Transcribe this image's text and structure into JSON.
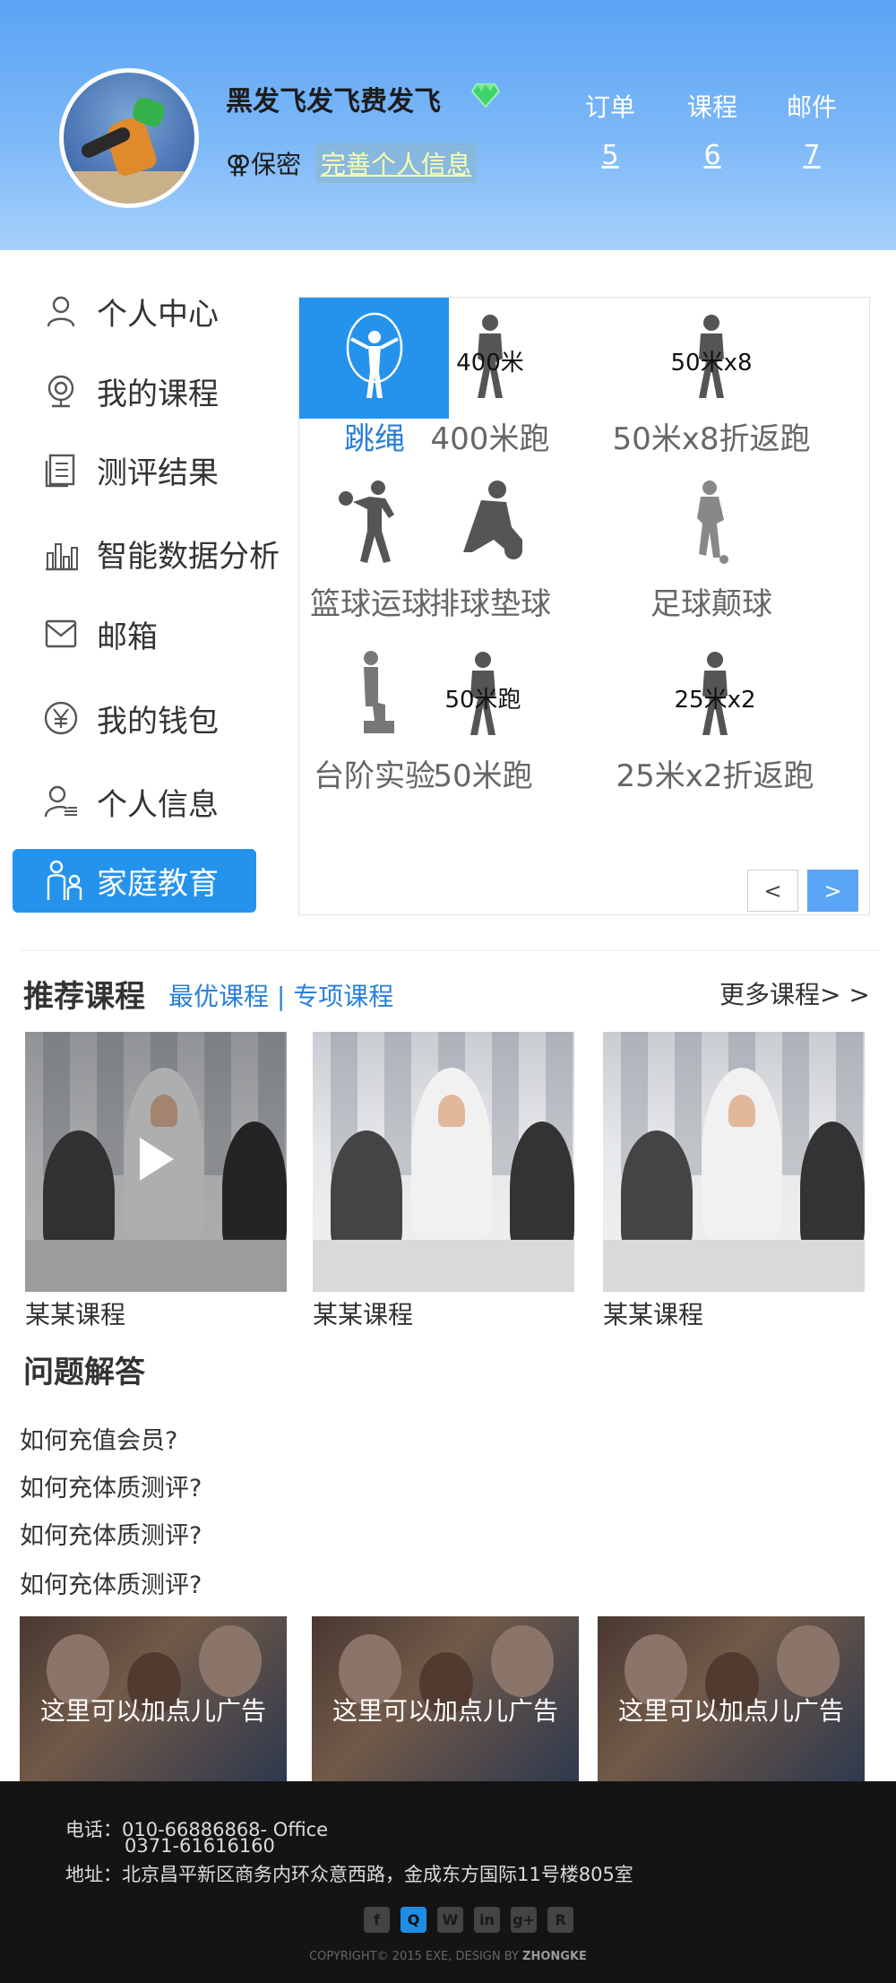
{
  "header": {
    "username": "黑发飞发飞费发飞",
    "gender_text": "保密",
    "complete_link": "完善个人信息",
    "stats": [
      {
        "label": "订单",
        "count": "5"
      },
      {
        "label": "课程",
        "count": "6"
      },
      {
        "label": "邮件",
        "count": "7"
      }
    ]
  },
  "sidebar": {
    "items": [
      {
        "label": "个人中心",
        "icon": "user-icon"
      },
      {
        "label": "我的课程",
        "icon": "webcam-icon"
      },
      {
        "label": "测评结果",
        "icon": "document-icon"
      },
      {
        "label": "智能数据分析",
        "icon": "bar-chart-icon"
      },
      {
        "label": "邮箱",
        "icon": "mail-icon"
      },
      {
        "label": "我的钱包",
        "icon": "yen-icon"
      },
      {
        "label": "个人信息",
        "icon": "profile-icon"
      },
      {
        "label": "家庭教育",
        "icon": "family-icon",
        "active": true
      }
    ]
  },
  "tests": {
    "tiles": [
      {
        "name": "跳绳",
        "overlay": "",
        "icon": "jump-rope-icon",
        "active": true
      },
      {
        "name": "400米跑",
        "overlay": "400米",
        "icon": "runner-icon"
      },
      {
        "name": "50米x8折返跑",
        "overlay": "50米x8",
        "icon": "runner-icon"
      },
      {
        "name": "篮球运球",
        "overlay": "",
        "icon": "basketball-icon"
      },
      {
        "name": "排球垫球",
        "overlay": "",
        "icon": "volleyball-icon"
      },
      {
        "name": "足球颠球",
        "overlay": "",
        "icon": "football-icon"
      },
      {
        "name": "台阶实验",
        "overlay": "",
        "icon": "step-test-icon"
      },
      {
        "name": "50米跑",
        "overlay": "50米跑",
        "icon": "runner-icon"
      },
      {
        "name": "25米x2折返跑",
        "overlay": "25米x2",
        "icon": "runner-icon"
      }
    ],
    "prev_label": "<",
    "next_label": ">"
  },
  "recommend": {
    "title": "推荐课程",
    "link1": "最优课程",
    "divider": "|",
    "link2": "专项课程",
    "more": "更多课程> >",
    "courses": [
      {
        "name": "某某课程"
      },
      {
        "name": "某某课程"
      },
      {
        "name": "某某课程"
      }
    ]
  },
  "qa": {
    "title": "问题解答",
    "items": [
      "如何充值会员?",
      "如何充体质测评?",
      "如何充体质测评?",
      "如何充体质测评?"
    ]
  },
  "ads": [
    "这里可以加点儿广告",
    "这里可以加点儿广告",
    "这里可以加点儿广告"
  ],
  "footer": {
    "phone_line1": "电话：010-66886868- Office",
    "phone_line2": "0371-61616160",
    "address": "地址：北京昌平新区商务内环众意西路，金成东方国际11号楼805室",
    "social": [
      {
        "icon": "facebook-icon",
        "glyph": "f"
      },
      {
        "icon": "qq-icon",
        "glyph": "Q"
      },
      {
        "icon": "wechat-icon",
        "glyph": "W"
      },
      {
        "icon": "linkedin-icon",
        "glyph": "in"
      },
      {
        "icon": "google-plus-icon",
        "glyph": "g+"
      },
      {
        "icon": "rss-icon",
        "glyph": "R"
      }
    ],
    "copyright_prefix": "COPYRIGHT© 2015 EXE, DESIGN BY ",
    "copyright_brand": "ZHONGKE"
  },
  "colors": {
    "accent": "#2593ec",
    "header_top": "#5aa3f4",
    "footer_bg": "#141414"
  }
}
